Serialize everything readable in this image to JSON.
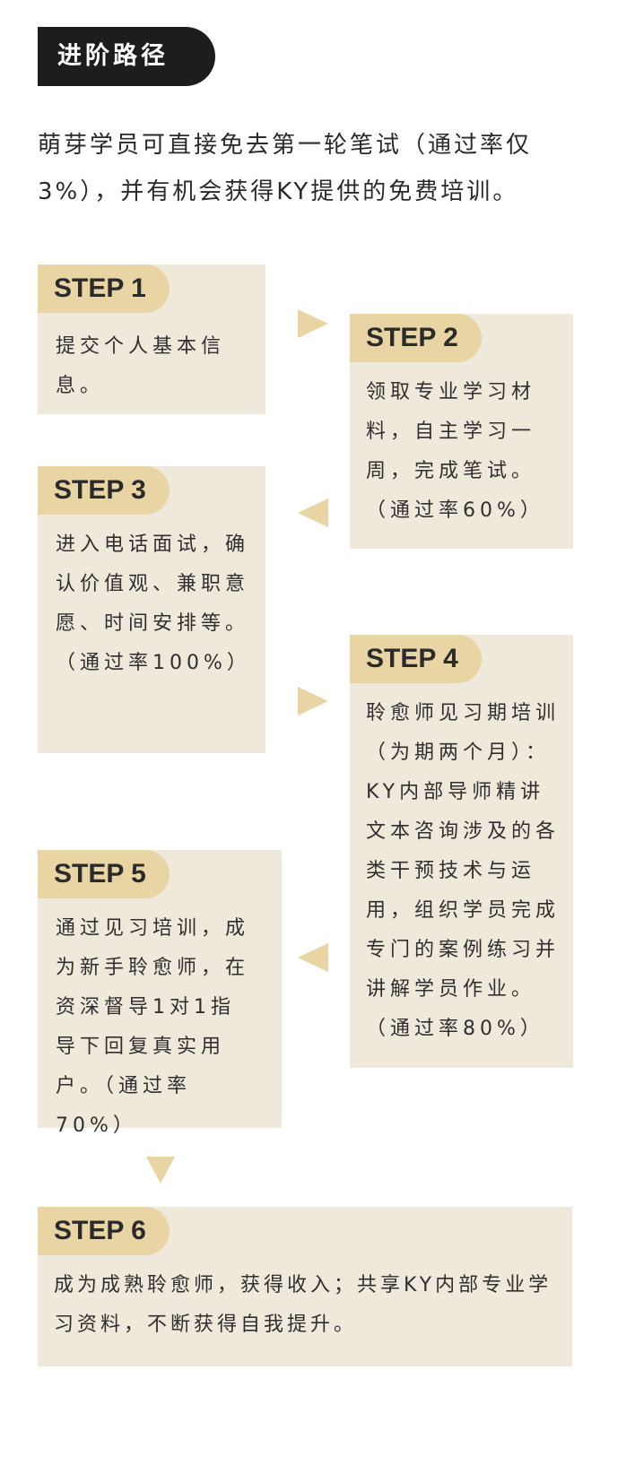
{
  "section": {
    "title": "进阶路径"
  },
  "intro": {
    "text": "萌芽学员可直接免去第一轮笔试（通过率仅3%），并有机会获得KY提供的免费培训。"
  },
  "steps": [
    {
      "label": "STEP 1",
      "text": "提交个人基本信息。"
    },
    {
      "label": "STEP 2",
      "text": "领取专业学习材料，自主学习一周，完成笔试。（通过率60%）"
    },
    {
      "label": "STEP 3",
      "text": "进入电话面试，确认价值观、兼职意愿、时间安排等。（通过率100%）"
    },
    {
      "label": "STEP 4",
      "text": "聆愈师见习期培训（为期两个月）：KY内部导师精讲文本咨询涉及的各类干预技术与运用，组织学员完成专门的案例练习并讲解学员作业。（通过率80%）"
    },
    {
      "label": "STEP 5",
      "text": "通过见习培训，成为新手聆愈师，在资深督导1对1指导下回复真实用户。（通过率70%）"
    },
    {
      "label": "STEP 6",
      "text": "成为成熟聆愈师，获得收入；共享KY内部专业学习资料，不断获得自我提升。"
    }
  ],
  "arrows": [
    {
      "icon": "triangle-right-icon"
    },
    {
      "icon": "triangle-left-icon"
    },
    {
      "icon": "triangle-right-icon"
    },
    {
      "icon": "triangle-left-icon"
    },
    {
      "icon": "triangle-down-icon"
    }
  ],
  "colors": {
    "tag_background": "#1d1d1d",
    "card_background": "#efe9dc",
    "label_background": "#e9d4a3",
    "arrow": "#e9d4a3",
    "text": "#2f2f2f"
  }
}
